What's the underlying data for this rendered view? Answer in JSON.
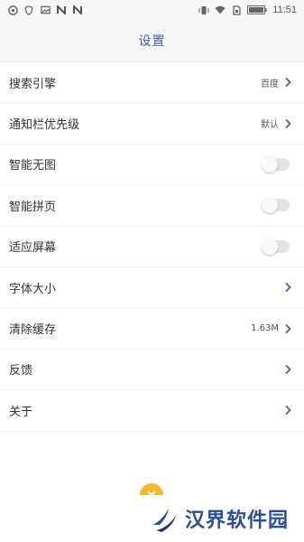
{
  "status_bar": {
    "time": "11:51",
    "left_icons": [
      "shutter-icon",
      "shield-icon",
      "image-icon",
      "n-icon",
      "n-icon"
    ],
    "right_icons": [
      "vibrate-icon",
      "wifi-icon",
      "sim-icon",
      "battery-icon"
    ]
  },
  "header": {
    "title": "设置"
  },
  "settings": {
    "items": [
      {
        "label": "搜索引擎",
        "value": "百度",
        "control": "chevron"
      },
      {
        "label": "通知栏优先级",
        "value": "默认",
        "control": "chevron"
      },
      {
        "label": "智能无图",
        "control": "toggle",
        "on": false
      },
      {
        "label": "智能拼页",
        "control": "toggle",
        "on": false
      },
      {
        "label": "适应屏幕",
        "control": "toggle",
        "on": false
      },
      {
        "label": "字体大小",
        "control": "chevron"
      },
      {
        "label": "清除缓存",
        "value": "1.63M",
        "control": "chevron"
      },
      {
        "label": "反馈",
        "control": "chevron"
      },
      {
        "label": "关于",
        "control": "chevron"
      }
    ]
  },
  "fab": {
    "icon": "close-icon",
    "color": "#f4b82a"
  },
  "watermark": {
    "text": "汉界软件园",
    "color": "#2a4d9c"
  },
  "colors": {
    "accent": "#4a5da8",
    "chevron": "#4a5da8"
  }
}
